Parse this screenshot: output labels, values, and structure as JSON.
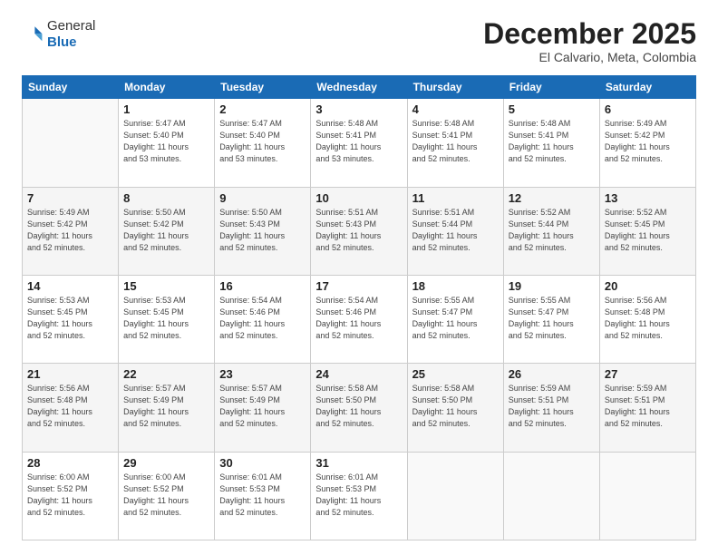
{
  "header": {
    "logo_line1": "General",
    "logo_line2": "Blue",
    "month": "December 2025",
    "location": "El Calvario, Meta, Colombia"
  },
  "weekdays": [
    "Sunday",
    "Monday",
    "Tuesday",
    "Wednesday",
    "Thursday",
    "Friday",
    "Saturday"
  ],
  "weeks": [
    [
      {
        "day": "",
        "info": ""
      },
      {
        "day": "1",
        "info": "Sunrise: 5:47 AM\nSunset: 5:40 PM\nDaylight: 11 hours\nand 53 minutes."
      },
      {
        "day": "2",
        "info": "Sunrise: 5:47 AM\nSunset: 5:40 PM\nDaylight: 11 hours\nand 53 minutes."
      },
      {
        "day": "3",
        "info": "Sunrise: 5:48 AM\nSunset: 5:41 PM\nDaylight: 11 hours\nand 53 minutes."
      },
      {
        "day": "4",
        "info": "Sunrise: 5:48 AM\nSunset: 5:41 PM\nDaylight: 11 hours\nand 52 minutes."
      },
      {
        "day": "5",
        "info": "Sunrise: 5:48 AM\nSunset: 5:41 PM\nDaylight: 11 hours\nand 52 minutes."
      },
      {
        "day": "6",
        "info": "Sunrise: 5:49 AM\nSunset: 5:42 PM\nDaylight: 11 hours\nand 52 minutes."
      }
    ],
    [
      {
        "day": "7",
        "info": "Sunrise: 5:49 AM\nSunset: 5:42 PM\nDaylight: 11 hours\nand 52 minutes."
      },
      {
        "day": "8",
        "info": "Sunrise: 5:50 AM\nSunset: 5:42 PM\nDaylight: 11 hours\nand 52 minutes."
      },
      {
        "day": "9",
        "info": "Sunrise: 5:50 AM\nSunset: 5:43 PM\nDaylight: 11 hours\nand 52 minutes."
      },
      {
        "day": "10",
        "info": "Sunrise: 5:51 AM\nSunset: 5:43 PM\nDaylight: 11 hours\nand 52 minutes."
      },
      {
        "day": "11",
        "info": "Sunrise: 5:51 AM\nSunset: 5:44 PM\nDaylight: 11 hours\nand 52 minutes."
      },
      {
        "day": "12",
        "info": "Sunrise: 5:52 AM\nSunset: 5:44 PM\nDaylight: 11 hours\nand 52 minutes."
      },
      {
        "day": "13",
        "info": "Sunrise: 5:52 AM\nSunset: 5:45 PM\nDaylight: 11 hours\nand 52 minutes."
      }
    ],
    [
      {
        "day": "14",
        "info": "Sunrise: 5:53 AM\nSunset: 5:45 PM\nDaylight: 11 hours\nand 52 minutes."
      },
      {
        "day": "15",
        "info": "Sunrise: 5:53 AM\nSunset: 5:45 PM\nDaylight: 11 hours\nand 52 minutes."
      },
      {
        "day": "16",
        "info": "Sunrise: 5:54 AM\nSunset: 5:46 PM\nDaylight: 11 hours\nand 52 minutes."
      },
      {
        "day": "17",
        "info": "Sunrise: 5:54 AM\nSunset: 5:46 PM\nDaylight: 11 hours\nand 52 minutes."
      },
      {
        "day": "18",
        "info": "Sunrise: 5:55 AM\nSunset: 5:47 PM\nDaylight: 11 hours\nand 52 minutes."
      },
      {
        "day": "19",
        "info": "Sunrise: 5:55 AM\nSunset: 5:47 PM\nDaylight: 11 hours\nand 52 minutes."
      },
      {
        "day": "20",
        "info": "Sunrise: 5:56 AM\nSunset: 5:48 PM\nDaylight: 11 hours\nand 52 minutes."
      }
    ],
    [
      {
        "day": "21",
        "info": "Sunrise: 5:56 AM\nSunset: 5:48 PM\nDaylight: 11 hours\nand 52 minutes."
      },
      {
        "day": "22",
        "info": "Sunrise: 5:57 AM\nSunset: 5:49 PM\nDaylight: 11 hours\nand 52 minutes."
      },
      {
        "day": "23",
        "info": "Sunrise: 5:57 AM\nSunset: 5:49 PM\nDaylight: 11 hours\nand 52 minutes."
      },
      {
        "day": "24",
        "info": "Sunrise: 5:58 AM\nSunset: 5:50 PM\nDaylight: 11 hours\nand 52 minutes."
      },
      {
        "day": "25",
        "info": "Sunrise: 5:58 AM\nSunset: 5:50 PM\nDaylight: 11 hours\nand 52 minutes."
      },
      {
        "day": "26",
        "info": "Sunrise: 5:59 AM\nSunset: 5:51 PM\nDaylight: 11 hours\nand 52 minutes."
      },
      {
        "day": "27",
        "info": "Sunrise: 5:59 AM\nSunset: 5:51 PM\nDaylight: 11 hours\nand 52 minutes."
      }
    ],
    [
      {
        "day": "28",
        "info": "Sunrise: 6:00 AM\nSunset: 5:52 PM\nDaylight: 11 hours\nand 52 minutes."
      },
      {
        "day": "29",
        "info": "Sunrise: 6:00 AM\nSunset: 5:52 PM\nDaylight: 11 hours\nand 52 minutes."
      },
      {
        "day": "30",
        "info": "Sunrise: 6:01 AM\nSunset: 5:53 PM\nDaylight: 11 hours\nand 52 minutes."
      },
      {
        "day": "31",
        "info": "Sunrise: 6:01 AM\nSunset: 5:53 PM\nDaylight: 11 hours\nand 52 minutes."
      },
      {
        "day": "",
        "info": ""
      },
      {
        "day": "",
        "info": ""
      },
      {
        "day": "",
        "info": ""
      }
    ]
  ]
}
